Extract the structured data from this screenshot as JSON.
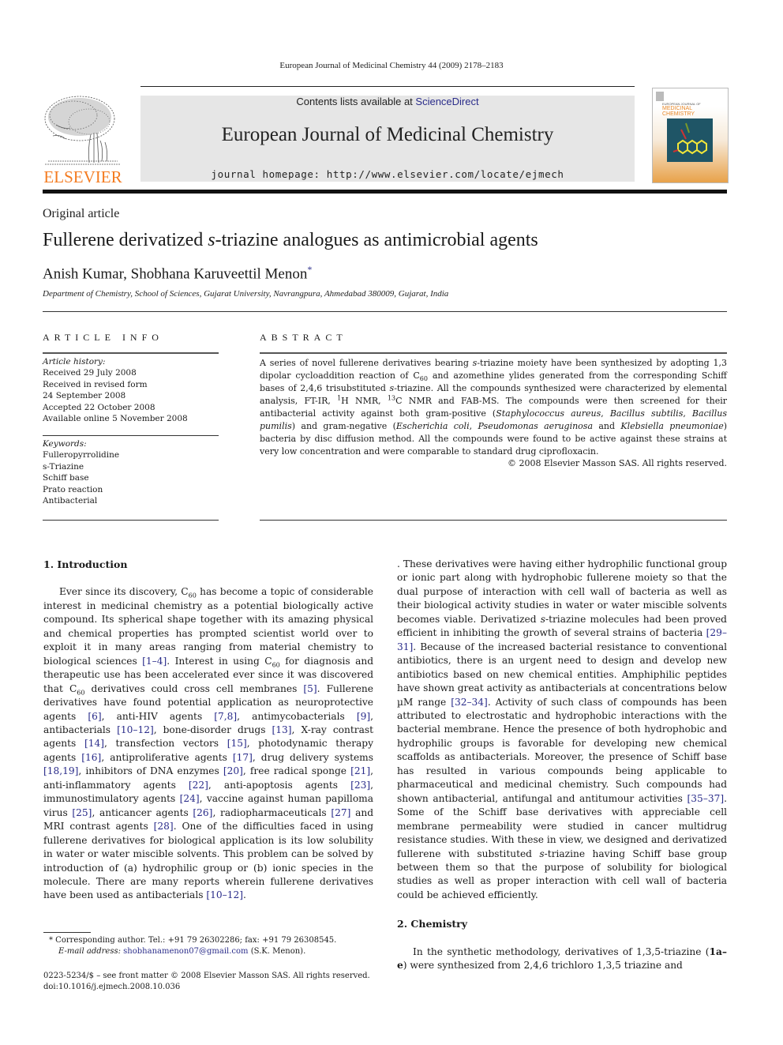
{
  "header": {
    "journal_reference": "European Journal of Medicinal Chemistry 44 (2009) 2178–2183",
    "contents_prefix": "Contents lists available at ",
    "contents_link": "ScienceDirect",
    "journal_title": "European Journal of Medicinal Chemistry",
    "homepage": "journal homepage: http://www.elsevier.com/locate/ejmech",
    "publisher_logo_text": "ELSEVIER",
    "cover_title_line1": "EUROPEAN JOURNAL OF",
    "cover_title_line2": "MEDICINAL",
    "cover_title_line3": "CHEMISTRY",
    "colors": {
      "publisher_orange": "#f47b20",
      "link_blue": "#2a2c8a",
      "banner_gray": "#e6e6e6"
    }
  },
  "article": {
    "type": "Original article",
    "title_part1": "Fullerene derivatized ",
    "title_italic": "s",
    "title_part2": "-triazine analogues as antimicrobial agents",
    "authors": "Anish Kumar, Shobhana Karuveettil Menon",
    "author_mark": "*",
    "affiliation": "Department of Chemistry, School of Sciences, Gujarat University, Navrangpura, Ahmedabad 380009, Gujarat, India"
  },
  "article_info": {
    "heading": "ARTICLE INFO",
    "history_label": "Article history:",
    "history": [
      "Received 29 July 2008",
      "Received in revised form",
      "24 September 2008",
      "Accepted 22 October 2008",
      "Available online 5 November 2008"
    ],
    "keywords_label": "Keywords:",
    "keywords": [
      "Fulleropyrrolidine",
      "s-Triazine",
      "Schiff base",
      "Prato reaction",
      "Antibacterial"
    ]
  },
  "abstract": {
    "heading": "ABSTRACT",
    "t1": "A series of novel fullerene derivatives bearing ",
    "t2": "s",
    "t3": "-triazine moiety have been synthesized by adopting 1,3 dipolar cycloaddition reaction of C",
    "t4": "60",
    "t5": " and azomethine ylides generated from the corresponding Schiff bases of 2,4,6 trisubstituted ",
    "t6": "s",
    "t7": "-triazine. All the compounds synthesized were characterized by elemental analysis, FT-IR, ",
    "t8": "1",
    "t9": "H NMR, ",
    "t10": "13",
    "t11": "C NMR and FAB-MS. The compounds were then screened for their antibacterial activity against both gram-positive (",
    "t12": "Staphylococcus aureus",
    "t13": ", ",
    "t14": "Bacillus subtilis",
    "t15": ", ",
    "t16": "Bacillus pumilis",
    "t17": ") and gram-negative (",
    "t18": "Escherichia coli",
    "t19": ", ",
    "t20": "Pseudomonas aeruginosa",
    "t21": " and ",
    "t22": "Klebsiella pneumoniae",
    "t23": ") bacteria by disc diffusion method. All the compounds were found to be active against these strains at very low concentration and were comparable to standard drug ciprofloxacin.",
    "copyright": "© 2008 Elsevier Masson SAS. All rights reserved."
  },
  "body": {
    "sec1_heading": "1.  Introduction",
    "p1": {
      "a": "Ever since its discovery, C",
      "a_sub": "60",
      "b": " has become a topic of considerable interest in medicinal chemistry as a potential biologically active compound. Its spherical shape together with its amazing physical and chemical properties has prompted scientist world over to exploit it in many areas ranging from material chemistry to biological sciences ",
      "r1": "[1–4]",
      "c": ". Interest in using C",
      "c_sub": "60",
      "d": " for diagnosis and therapeutic use has been accelerated ever since it was discovered that C",
      "d_sub": "60",
      "e": " derivatives could cross cell membranes ",
      "r2": "[5]",
      "f": ". Fullerene derivatives have found potential application as neuroprotective agents ",
      "r3": "[6]",
      "g": ", anti-HIV agents ",
      "r4": "[7,8]",
      "h": ", antimycobacterials ",
      "r5": "[9]",
      "i": ", antibacterials ",
      "r6": "[10–12]",
      "j": ", bone-disorder drugs ",
      "r7": "[13]",
      "k": ", X-ray contrast agents ",
      "r8": "[14]",
      "l": ", transfection vectors ",
      "r9": "[15]",
      "m": ", photodynamic therapy agents ",
      "r10": "[16]",
      "n": ", antiproliferative agents ",
      "r11": "[17]",
      "o": ", drug delivery systems ",
      "r12": "[18,19]",
      "p": ", inhibitors of DNA enzymes ",
      "r13": "[20]",
      "q": ", free radical sponge ",
      "r14": "[21]",
      "r": ", anti-inflammatory agents ",
      "r15": "[22]",
      "s": ", anti-apoptosis agents ",
      "r16": "[23]",
      "t": ", immunostimulatory agents ",
      "r17": "[24]",
      "u": ", vaccine against human papilloma virus ",
      "r18": "[25]",
      "v": ", anticancer agents ",
      "r19": "[26]",
      "w": ", radiopharmaceuticals ",
      "r20": "[27]",
      "x": " and MRI contrast agents ",
      "r21": "[28]",
      "y": ". One of the difficulties faced in using fullerene derivatives for biological application is its low solubility in water or water miscible solvents. This problem can be solved by introduction of (a) hydrophilic group or (b) ionic species in the molecule. There are many reports wherein fullerene derivatives have been used as antibacterials ",
      "r22": "[10–12]",
      "z": ". These derivatives were having either hydrophilic functional group or ionic part along with hydrophobic fullerene moiety so that the dual purpose of interaction with cell wall of bacteria as well as their biological activity studies in water or water miscible solvents becomes viable. Derivatized ",
      "z_it": "s",
      "z2": "-triazine molecules had been proved efficient in inhibiting the growth of several strains of bacteria ",
      "r23": "[29–31]",
      "z3": ". Because of the increased bacterial resistance to conventional antibiotics, there is an urgent need to design and develop new antibiotics based on new chemical entities. Amphiphilic peptides have shown great activity as antibacterials at concentrations below µM range ",
      "r24": "[32–34]",
      "z4": ". Activity of such class of compounds has been attributed to electrostatic and hydrophobic interactions with the bacterial membrane. Hence the presence of both hydrophobic and hydrophilic groups is favorable for developing new chemical scaffolds as antibacterials. Moreover, the presence of Schiff base has resulted in various compounds being applicable to pharmaceutical and medicinal chemistry. Such compounds had shown antibacterial, antifungal and antitumour activities ",
      "r25": "[35–37]",
      "z5": ". Some of the Schiff base derivatives with appreciable cell membrane permeability were studied in cancer multidrug resistance studies. With these in view, we designed and derivatized fullerene with substituted ",
      "z5_it": "s",
      "z6": "-triazine having Schiff base group between them so that the purpose of solubility for biological studies as well as proper interaction with cell wall of bacteria could be achieved efficiently."
    },
    "sec2_heading": "2.  Chemistry",
    "p2": {
      "a": "In the synthetic methodology, derivatives of 1,3,5-triazine (",
      "b": "1a–e",
      "c": ") were synthesized from 2,4,6 trichloro 1,3,5 triazine and"
    }
  },
  "footnotes": {
    "mark": "*",
    "corresponding": " Corresponding author. Tel.: +91 79 26302286; fax: +91 79 26308545.",
    "email_label": "E-mail address: ",
    "email": "shobhanamenon07@gmail.com",
    "email_suffix": " (S.K. Menon).",
    "front_matter": "0223-5234/$ – see front matter © 2008 Elsevier Masson SAS. All rights reserved.",
    "doi": "doi:10.1016/j.ejmech.2008.10.036"
  }
}
